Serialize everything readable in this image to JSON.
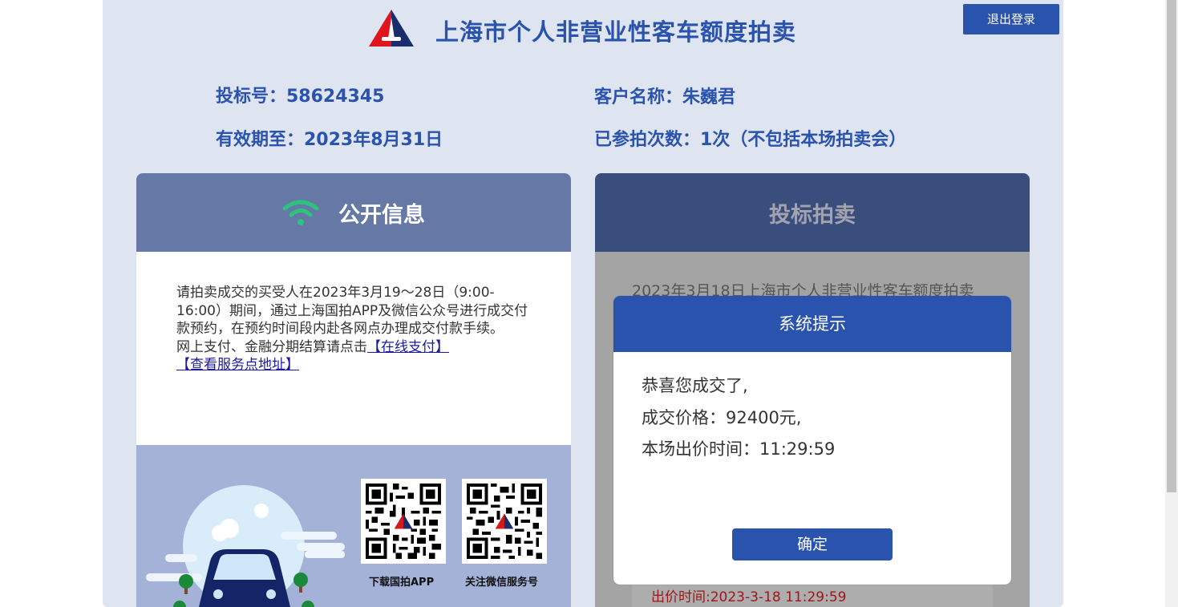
{
  "header": {
    "logo_icon": "auction-logo-icon",
    "title": "上海市个人非营业性客车额度拍卖",
    "logout_label": "退出登录"
  },
  "user_info": {
    "bid_number": "投标号：58624345",
    "customer_name": "客户名称：朱巍君",
    "valid_until": "有效期至：2023年8月31日",
    "participation_count": "已参拍次数：1次（不包括本场拍卖会）"
  },
  "public_info": {
    "icon": "wifi-icon",
    "title": "公开信息",
    "body": "请拍卖成交的买受人在2023年3月19～28日（9:00-16:00）期间，通过上海国拍APP及微信公众号进行成交付款预约，在预约时间段内赴各网点办理成交付款手续。",
    "payment_prefix": "网上支付、金融分期结算请点击",
    "online_pay_link": "【在线支付】",
    "service_link": "【查看服务点地址】"
  },
  "promo": {
    "app_qr_label": "下载国拍APP",
    "wechat_qr_label": "关注微信服务号"
  },
  "bidding": {
    "title": "投标拍卖",
    "auction_text": "2023年3月18日上海市个人非营业性客车额度拍卖",
    "bid_time": "出价时间:2023-3-18 11:29:59"
  },
  "modal": {
    "title": "系统提示",
    "line1": "恭喜您成交了,",
    "line2": "成交价格：92400元,",
    "line3": "本场出价时间：11:29:59",
    "confirm_label": "确定"
  },
  "colors": {
    "brand_blue": "#2a53ad",
    "page_bg": "#dfe4f1",
    "public_header": "#6678a6",
    "bidding_header": "#3a4e7e",
    "wifi_green": "#2ec27e",
    "bid_time_red": "#a01616"
  }
}
